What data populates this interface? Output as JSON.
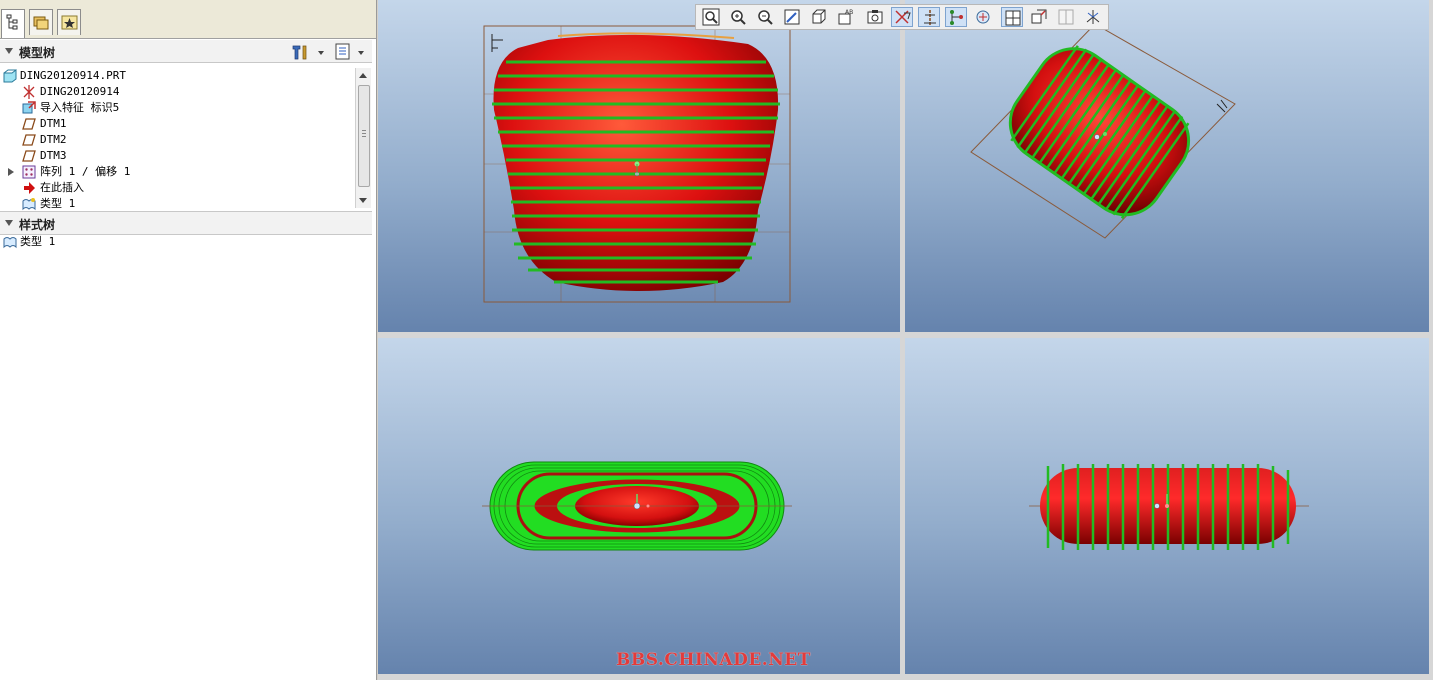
{
  "model_tree": {
    "title": "模型树",
    "items": [
      {
        "label": "DING20120914.PRT",
        "icon": "part-icon"
      },
      {
        "label": "DING20120914",
        "icon": "coordinate-system-icon"
      },
      {
        "label": "导入特征 标识5",
        "icon": "import-feature-icon"
      },
      {
        "label": "DTM1",
        "icon": "datum-plane-icon"
      },
      {
        "label": "DTM2",
        "icon": "datum-plane-icon"
      },
      {
        "label": "DTM3",
        "icon": "datum-plane-icon"
      },
      {
        "label": "阵列 1 / 偏移 1",
        "icon": "pattern-icon"
      },
      {
        "label": "在此插入",
        "icon": "insert-here-arrow-icon"
      },
      {
        "label": "类型 1",
        "icon": "style-icon"
      }
    ]
  },
  "style_tree": {
    "title": "样式树",
    "items": [
      {
        "label": "类型 1",
        "icon": "style-icon"
      }
    ]
  },
  "toolbar": {
    "buttons": [
      "refit-icon",
      "zoom-in-icon",
      "zoom-out-icon",
      "repaint-icon",
      "orient-icon",
      "saved-views-icon",
      "view-manager-icon",
      "datum-planes-toggle-icon",
      "datum-axes-toggle-icon",
      "datum-points-toggle-icon",
      "csys-toggle-icon",
      "all-views-icon",
      "active-view-icon",
      "unused-view-icon",
      "spin-center-icon"
    ]
  },
  "watermark": "BBS.CHINADE.NET",
  "colors": {
    "surface": "#dd1010",
    "section_curves": "#22cc22",
    "frame": "#8a5a3a",
    "bg_top": "#c4d6ea",
    "bg_bottom": "#6583ad"
  }
}
